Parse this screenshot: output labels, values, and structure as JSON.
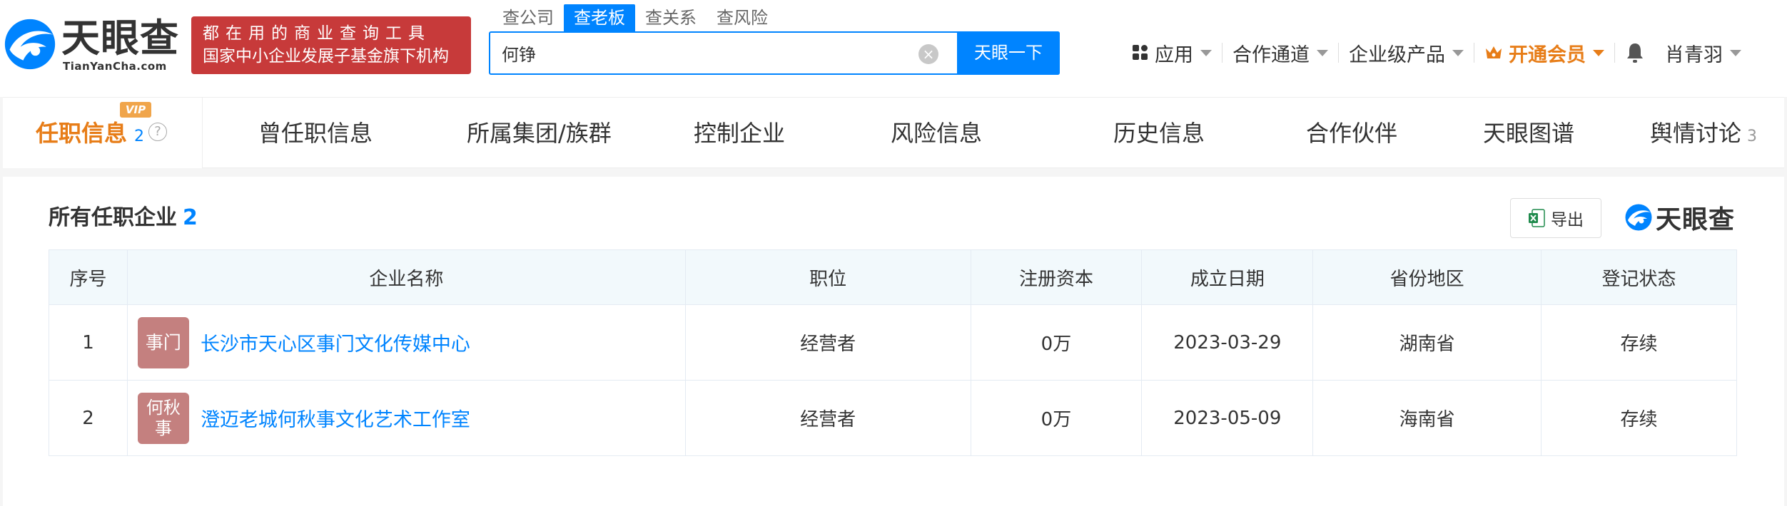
{
  "logo": {
    "cn": "天眼查",
    "en": "TianYanCha.com"
  },
  "slogan": {
    "line1": "都在用的商业查询工具",
    "line2": "国家中小企业发展子基金旗下机构"
  },
  "search": {
    "tabs": [
      "查公司",
      "查老板",
      "查关系",
      "查风险"
    ],
    "active_tab": "查老板",
    "value": "何铮",
    "button": "天眼一下"
  },
  "topnav": {
    "apps": "应用",
    "partner": "合作通道",
    "enterprise": "企业级产品",
    "vip": "开通会员",
    "user": "肖青羽"
  },
  "subtabs": {
    "active": {
      "label": "任职信息",
      "count": "2",
      "badge": "VIP"
    },
    "items": [
      "曾任职信息",
      "所属集团/族群",
      "控制企业",
      "风险信息",
      "历史信息",
      "合作伙伴",
      "天眼图谱",
      "舆情讨论"
    ],
    "last_count": "3"
  },
  "section": {
    "title": "所有任职企业",
    "count": "2",
    "export": "导出",
    "brand": "天眼查"
  },
  "table": {
    "headers": [
      "序号",
      "企业名称",
      "职位",
      "注册资本",
      "成立日期",
      "省份地区",
      "登记状态"
    ],
    "rows": [
      {
        "index": "1",
        "avatar": "事门",
        "name": "长沙市天心区事门文化传媒中心",
        "position": "经营者",
        "capital": "0万",
        "date": "2023-03-29",
        "region": "湖南省",
        "status": "存续"
      },
      {
        "index": "2",
        "avatar": "何秋事",
        "name": "澄迈老城何秋事文化艺术工作室",
        "position": "经营者",
        "capital": "0万",
        "date": "2023-05-09",
        "region": "海南省",
        "status": "存续"
      }
    ]
  },
  "colors": {
    "brand_blue": "#0084ff",
    "slogan_red": "#c73a3a",
    "vip_orange": "#e77d18",
    "status_green": "#3c9a3c",
    "avatar_bg": "#c4807f"
  }
}
